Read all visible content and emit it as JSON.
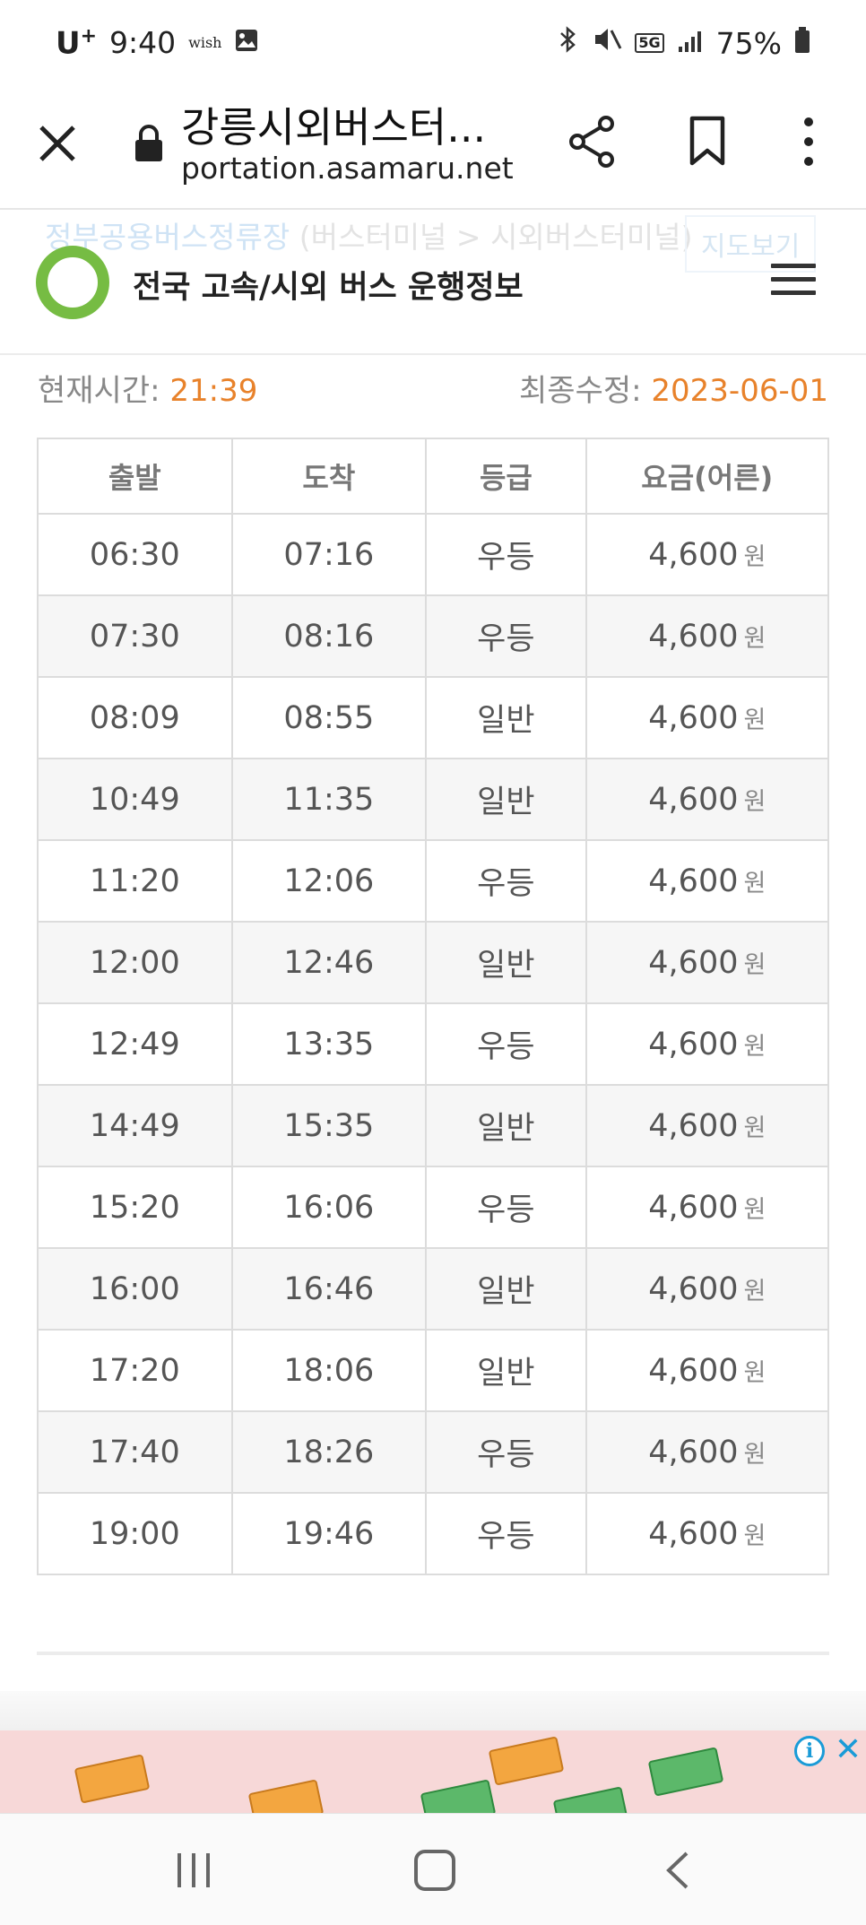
{
  "status_bar": {
    "carrier": "U",
    "carrier_sup": "+",
    "time": "9:40",
    "wish": "wish",
    "network": "5G",
    "battery": "75%"
  },
  "browser": {
    "title": "강릉시외버스터...",
    "url": "portation.asamaru.net",
    "icons": [
      "close-icon",
      "lock-icon",
      "share-icon",
      "bookmark-icon",
      "more-icon"
    ]
  },
  "site": {
    "ghost_text": "정부공용버스정류장",
    "ghost_sub": " (버스터미널 > 시외버스터미널)",
    "ghost_button": "지도보기",
    "title": "전국 고속/시외 버스 운행정보",
    "accent": "#76bc43"
  },
  "info": {
    "current_label": "현재시간: ",
    "current_time": "21:39",
    "modified_label": "최종수정: ",
    "modified_date": "2023-06-01",
    "highlight_color": "#e8822b"
  },
  "table": {
    "headers": [
      "출발",
      "도착",
      "등급",
      "요금(어른)"
    ],
    "currency": "원",
    "rows": [
      {
        "dep": "06:30",
        "arr": "07:16",
        "grade": "우등",
        "fare": "4,600"
      },
      {
        "dep": "07:30",
        "arr": "08:16",
        "grade": "우등",
        "fare": "4,600"
      },
      {
        "dep": "08:09",
        "arr": "08:55",
        "grade": "일반",
        "fare": "4,600"
      },
      {
        "dep": "10:49",
        "arr": "11:35",
        "grade": "일반",
        "fare": "4,600"
      },
      {
        "dep": "11:20",
        "arr": "12:06",
        "grade": "우등",
        "fare": "4,600"
      },
      {
        "dep": "12:00",
        "arr": "12:46",
        "grade": "일반",
        "fare": "4,600"
      },
      {
        "dep": "12:49",
        "arr": "13:35",
        "grade": "우등",
        "fare": "4,600"
      },
      {
        "dep": "14:49",
        "arr": "15:35",
        "grade": "일반",
        "fare": "4,600"
      },
      {
        "dep": "15:20",
        "arr": "16:06",
        "grade": "우등",
        "fare": "4,600"
      },
      {
        "dep": "16:00",
        "arr": "16:46",
        "grade": "일반",
        "fare": "4,600"
      },
      {
        "dep": "17:20",
        "arr": "18:06",
        "grade": "일반",
        "fare": "4,600"
      },
      {
        "dep": "17:40",
        "arr": "18:26",
        "grade": "우등",
        "fare": "4,600"
      },
      {
        "dep": "19:00",
        "arr": "19:46",
        "grade": "우등",
        "fare": "4,600"
      }
    ]
  },
  "ad": {
    "info_glyph": "i",
    "close_glyph": "✕"
  },
  "navbar": {
    "icons": [
      "recent-apps-icon",
      "home-icon",
      "back-icon"
    ]
  }
}
